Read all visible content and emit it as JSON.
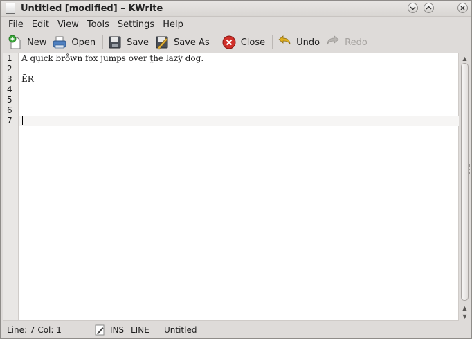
{
  "window": {
    "title": "Untitled [modified] – KWrite"
  },
  "menu": [
    {
      "label": "File",
      "mnemonic": "F",
      "rest": "ile"
    },
    {
      "label": "Edit",
      "mnemonic": "E",
      "rest": "dit"
    },
    {
      "label": "View",
      "mnemonic": "V",
      "rest": "iew"
    },
    {
      "label": "Tools",
      "mnemonic": "T",
      "rest": "ools"
    },
    {
      "label": "Settings",
      "mnemonic": "S",
      "rest": "ettings"
    },
    {
      "label": "Help",
      "mnemonic": "H",
      "rest": "elp"
    }
  ],
  "toolbar": {
    "new": "New",
    "open": "Open",
    "save": "Save",
    "save_as": "Save As",
    "close": "Close",
    "undo": "Undo",
    "redo": "Redo"
  },
  "editor": {
    "lines": [
      {
        "number": "1",
        "text": "A qu̧ick bro̊wn fox jumps ōver t̯he lāzÿ dog."
      },
      {
        "number": "2",
        "text": ""
      },
      {
        "number": "3",
        "text": "ĒR"
      },
      {
        "number": "4",
        "text": ""
      },
      {
        "number": "5",
        "text": ""
      },
      {
        "number": "6",
        "text": ""
      },
      {
        "number": "7",
        "text": ""
      }
    ],
    "current_line": 7
  },
  "status": {
    "position": "Line: 7 Col: 1",
    "mode": "INS",
    "selection_mode": "LINE",
    "document": "Untitled"
  },
  "icons": {
    "new": "new-document-icon",
    "open": "open-printer-icon",
    "save": "floppy-disk-icon",
    "save_as": "save-as-icon",
    "close": "close-red-icon",
    "undo": "undo-arrow-icon",
    "redo": "redo-arrow-icon"
  },
  "colors": {
    "close_red": "#d0302a",
    "undo_yellow": "#e0b020",
    "current_line_bg": "#f6f5f4"
  }
}
